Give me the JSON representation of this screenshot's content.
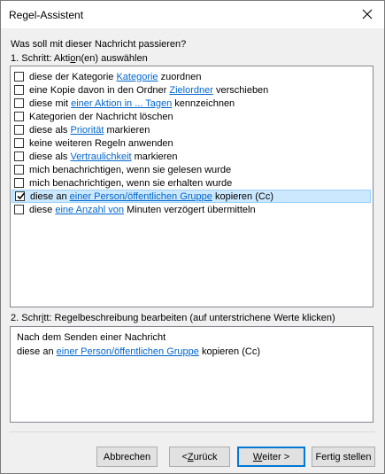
{
  "window": {
    "title": "Regel-Assistent",
    "close_icon": "close-icon"
  },
  "prompt": "Was soll mit dieser Nachricht passieren?",
  "step1": {
    "pre": "1. Schritt: Akti",
    "key": "o",
    "post": "n(en) auswählen"
  },
  "actions": [
    {
      "checked": false,
      "pre": "diese der Kategorie ",
      "link": "Kategorie",
      "post": " zuordnen"
    },
    {
      "checked": false,
      "pre": "eine Kopie davon in den Ordner ",
      "link": "Zielordner",
      "post": " verschieben"
    },
    {
      "checked": false,
      "pre": "diese mit ",
      "link": "einer Aktion in ... Tagen",
      "post": " kennzeichnen"
    },
    {
      "checked": false,
      "pre": "Kategorien der Nachricht löschen",
      "link": "",
      "post": ""
    },
    {
      "checked": false,
      "pre": "diese als ",
      "link": "Priorität",
      "post": " markieren"
    },
    {
      "checked": false,
      "pre": "keine weiteren Regeln anwenden",
      "link": "",
      "post": ""
    },
    {
      "checked": false,
      "pre": "diese als ",
      "link": "Vertraulichkeit",
      "post": " markieren"
    },
    {
      "checked": false,
      "pre": "mich benachrichtigen, wenn sie gelesen wurde",
      "link": "",
      "post": ""
    },
    {
      "checked": false,
      "pre": "mich benachrichtigen, wenn sie erhalten wurde",
      "link": "",
      "post": ""
    },
    {
      "checked": true,
      "selected": true,
      "pre": "diese an ",
      "link": "einer Person/öffentlichen Gruppe",
      "post": " kopieren (Cc)"
    },
    {
      "checked": false,
      "pre": "diese ",
      "link": "eine Anzahl von",
      "post": " Minuten verzögert übermitteln"
    }
  ],
  "step2": {
    "pre": "2. Schr",
    "key": "i",
    "post": "tt: Regelbeschreibung bearbeiten (auf unterstrichene Werte klicken)"
  },
  "description": {
    "line1": "Nach dem Senden einer Nachricht",
    "line2_pre": "diese an ",
    "line2_link": "einer Person/öffentlichen Gruppe",
    "line2_post": " kopieren (Cc)"
  },
  "buttons": {
    "cancel": "Abbrechen",
    "back_pre": "< ",
    "back_key": "Z",
    "back_post": "urück",
    "next_key": "W",
    "next_post": "eiter >",
    "finish": "Fertig stellen"
  }
}
